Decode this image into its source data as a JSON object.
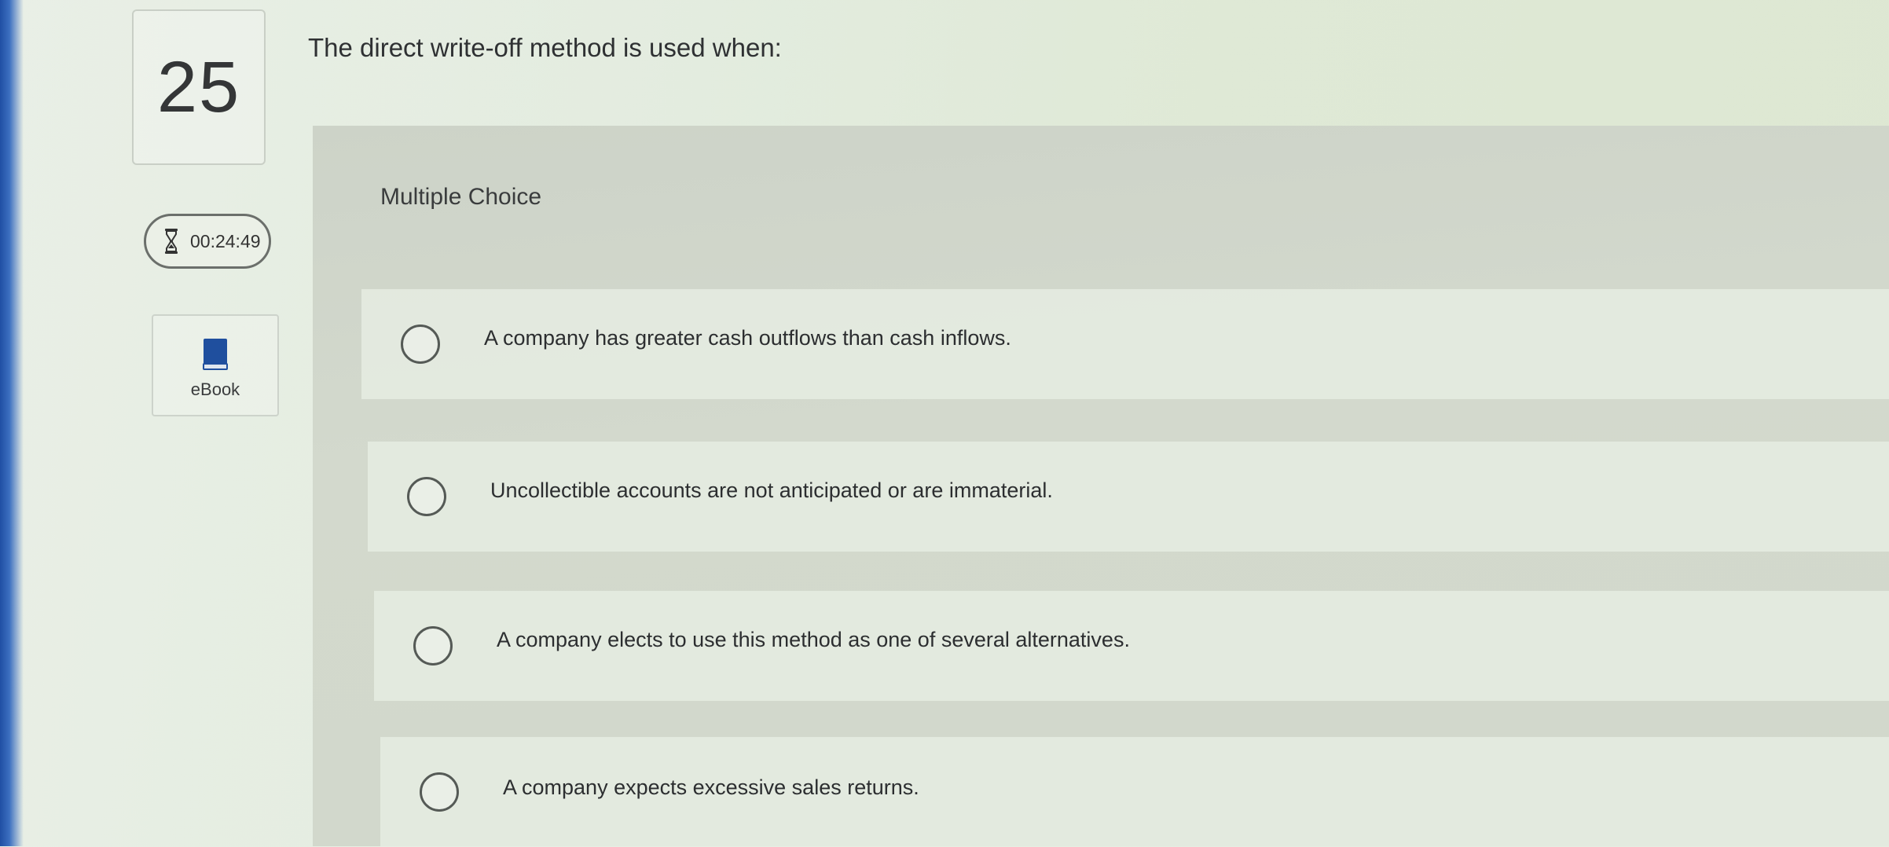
{
  "question": {
    "number": "25",
    "text": "The direct write-off method is used when:"
  },
  "timer": {
    "icon": "hourglass-icon",
    "value": "00:24:49"
  },
  "ebook": {
    "icon": "book-icon",
    "label": "eBook"
  },
  "answer_type": "Multiple Choice",
  "options": [
    {
      "label": "A company has greater cash outflows than cash inflows."
    },
    {
      "label": "Uncollectible accounts are not anticipated or are immaterial."
    },
    {
      "label": "A company elects to use this method as one of several alternatives."
    },
    {
      "label": "A company expects excessive sales returns."
    }
  ],
  "colors": {
    "accent_edge": "#1f4fa3",
    "radio_border": "#555a56"
  }
}
